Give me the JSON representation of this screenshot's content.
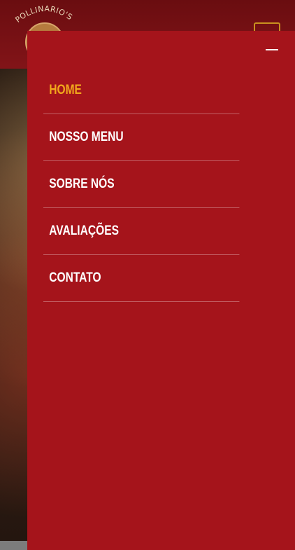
{
  "header": {
    "logo_text": "POLLINARIO'S"
  },
  "nav": {
    "items": [
      {
        "label": "HOME",
        "active": true
      },
      {
        "label": "NOSSO MENU",
        "active": false
      },
      {
        "label": "SOBRE NÓS",
        "active": false
      },
      {
        "label": "AVALIAÇÕES",
        "active": false
      },
      {
        "label": "CONTATO",
        "active": false
      }
    ]
  },
  "colors": {
    "drawer_bg": "#a5141b",
    "active_link": "#f2a71c",
    "header_bg": "#821418",
    "toggle_gold": "#c9911f"
  },
  "icons": {
    "close": "minus-close-icon",
    "menu": "hamburger-icon"
  }
}
